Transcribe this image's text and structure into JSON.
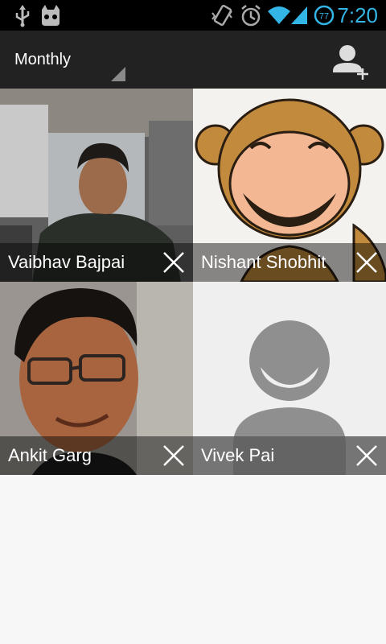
{
  "status_bar": {
    "time": "7:20",
    "battery_level": "77",
    "icons": [
      "usb-icon",
      "cyanogenmod-icon",
      "vibrate-icon",
      "alarm-icon",
      "wifi-icon",
      "signal-icon",
      "battery-icon"
    ]
  },
  "action_bar": {
    "period_selector": "Monthly",
    "add_contact_icon": "add-contact-icon"
  },
  "contacts": [
    {
      "name": "Vaibhav Bajpai",
      "remove_icon": "close-icon"
    },
    {
      "name": "Nishant Shobhit",
      "remove_icon": "close-icon"
    },
    {
      "name": "Ankit Garg",
      "remove_icon": "close-icon"
    },
    {
      "name": "Vivek Pai",
      "remove_icon": "close-icon"
    }
  ],
  "colors": {
    "status_accent": "#33b5e5",
    "action_bar": "#222222",
    "background": "#f7f7f7"
  }
}
